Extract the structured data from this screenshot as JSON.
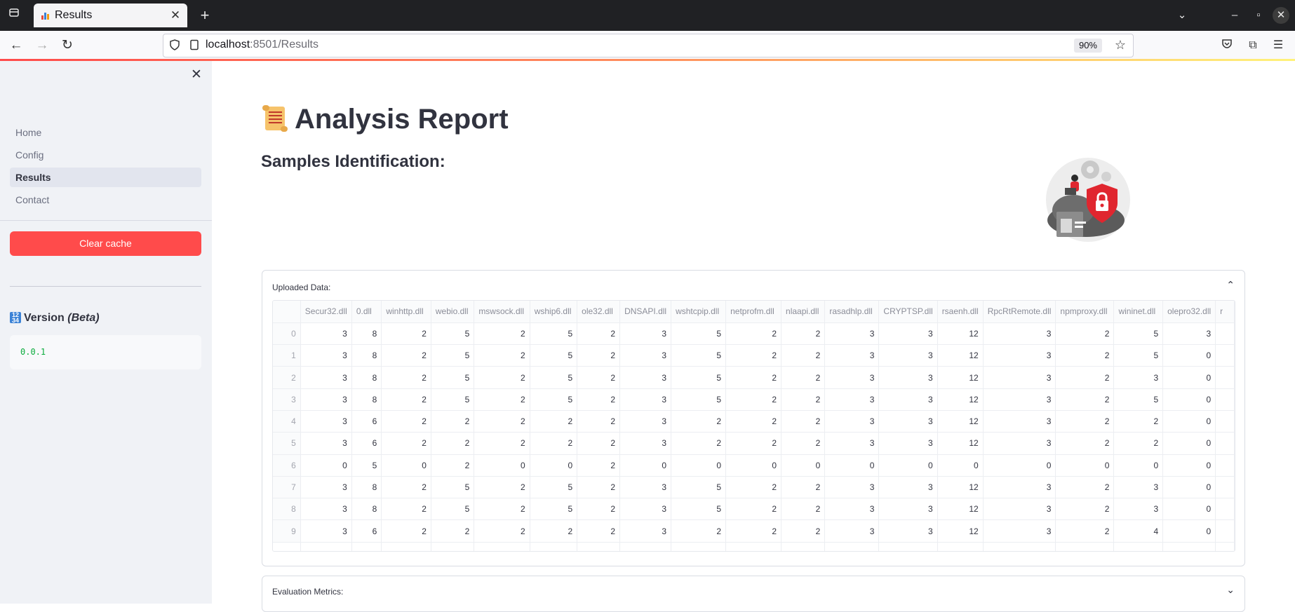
{
  "browser": {
    "tab_title": "Results",
    "url_host": "localhost",
    "url_path": ":8501/Results",
    "zoom": "90%"
  },
  "sidebar": {
    "items": [
      {
        "label": "Home",
        "active": false
      },
      {
        "label": "Config",
        "active": false
      },
      {
        "label": "Results",
        "active": true
      },
      {
        "label": "Contact",
        "active": false
      }
    ],
    "clear_cache": "Clear cache",
    "version_label": "Version",
    "version_note": "(Beta)",
    "version_value": "0.0.1"
  },
  "main": {
    "title": "Analysis Report",
    "subheader": "Samples Identification:",
    "uploaded_label": "Uploaded Data:",
    "metrics_label": "Evaluation Metrics:"
  },
  "table": {
    "columns": [
      "Secur32.dll",
      "0.dll",
      "winhttp.dll",
      "webio.dll",
      "mswsock.dll",
      "wship6.dll",
      "ole32.dll",
      "DNSAPI.dll",
      "wshtcpip.dll",
      "netprofm.dll",
      "nlaapi.dll",
      "rasadhlp.dll",
      "CRYPTSP.dll",
      "rsaenh.dll",
      "RpcRtRemote.dll",
      "npmproxy.dll",
      "wininet.dll",
      "olepro32.dll",
      "r"
    ],
    "rows": [
      {
        "index": "0",
        "values": [
          "3",
          "8",
          "2",
          "5",
          "2",
          "5",
          "2",
          "3",
          "5",
          "2",
          "2",
          "3",
          "3",
          "12",
          "3",
          "2",
          "5",
          "3",
          ""
        ]
      },
      {
        "index": "1",
        "values": [
          "3",
          "8",
          "2",
          "5",
          "2",
          "5",
          "2",
          "3",
          "5",
          "2",
          "2",
          "3",
          "3",
          "12",
          "3",
          "2",
          "5",
          "0",
          ""
        ]
      },
      {
        "index": "2",
        "values": [
          "3",
          "8",
          "2",
          "5",
          "2",
          "5",
          "2",
          "3",
          "5",
          "2",
          "2",
          "3",
          "3",
          "12",
          "3",
          "2",
          "3",
          "0",
          ""
        ]
      },
      {
        "index": "3",
        "values": [
          "3",
          "8",
          "2",
          "5",
          "2",
          "5",
          "2",
          "3",
          "5",
          "2",
          "2",
          "3",
          "3",
          "12",
          "3",
          "2",
          "5",
          "0",
          ""
        ]
      },
      {
        "index": "4",
        "values": [
          "3",
          "6",
          "2",
          "2",
          "2",
          "2",
          "2",
          "3",
          "2",
          "2",
          "2",
          "3",
          "3",
          "12",
          "3",
          "2",
          "2",
          "0",
          ""
        ]
      },
      {
        "index": "5",
        "values": [
          "3",
          "6",
          "2",
          "2",
          "2",
          "2",
          "2",
          "3",
          "2",
          "2",
          "2",
          "3",
          "3",
          "12",
          "3",
          "2",
          "2",
          "0",
          ""
        ]
      },
      {
        "index": "6",
        "values": [
          "0",
          "5",
          "0",
          "2",
          "0",
          "0",
          "2",
          "0",
          "0",
          "0",
          "0",
          "0",
          "0",
          "0",
          "0",
          "0",
          "0",
          "0",
          ""
        ]
      },
      {
        "index": "7",
        "values": [
          "3",
          "8",
          "2",
          "5",
          "2",
          "5",
          "2",
          "3",
          "5",
          "2",
          "2",
          "3",
          "3",
          "12",
          "3",
          "2",
          "3",
          "0",
          ""
        ]
      },
      {
        "index": "8",
        "values": [
          "3",
          "8",
          "2",
          "5",
          "2",
          "5",
          "2",
          "3",
          "5",
          "2",
          "2",
          "3",
          "3",
          "12",
          "3",
          "2",
          "3",
          "0",
          ""
        ]
      },
      {
        "index": "9",
        "values": [
          "3",
          "6",
          "2",
          "2",
          "2",
          "2",
          "2",
          "3",
          "2",
          "2",
          "2",
          "3",
          "3",
          "12",
          "3",
          "2",
          "4",
          "0",
          ""
        ]
      }
    ]
  }
}
